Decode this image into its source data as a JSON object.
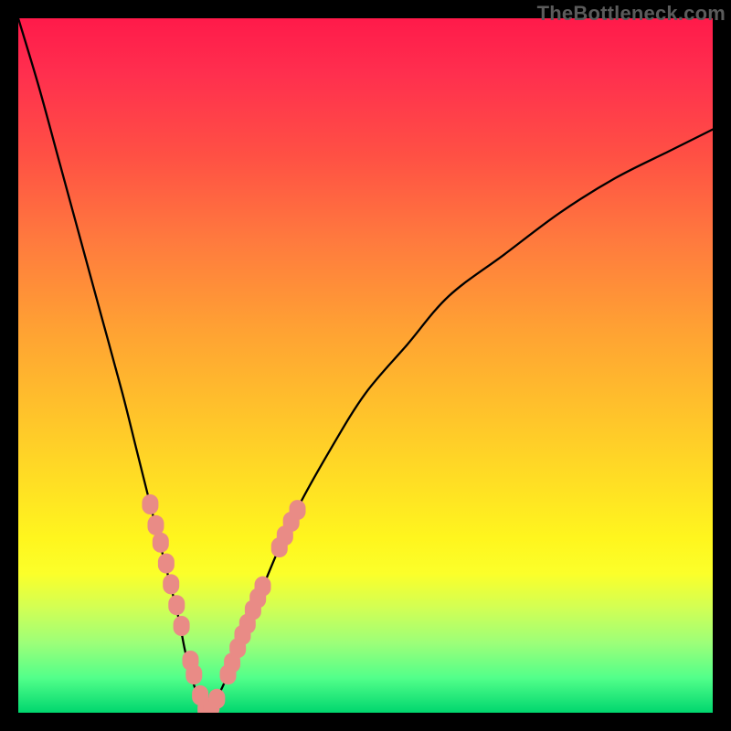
{
  "watermark": "TheBottleneck.com",
  "colors": {
    "background_black": "#000000",
    "gradient_top": "#ff1a4a",
    "gradient_bottom": "#00d66e",
    "curve": "#000000",
    "marker": "#e98b86"
  },
  "chart_data": {
    "type": "line",
    "title": "",
    "xlabel": "",
    "ylabel": "",
    "xlim": [
      0,
      100
    ],
    "ylim": [
      0,
      100
    ],
    "grid": false,
    "annotations": [
      "TheBottleneck.com"
    ],
    "series": [
      {
        "name": "bottleneck-curve",
        "x": [
          0,
          3,
          6,
          9,
          12,
          15,
          17,
          19,
          21,
          23,
          24,
          25,
          26,
          27,
          28,
          30,
          33,
          36,
          40,
          45,
          50,
          56,
          62,
          70,
          78,
          86,
          94,
          100
        ],
        "values": [
          100,
          90,
          79,
          68,
          57,
          46,
          38,
          30,
          22,
          14,
          9,
          5,
          2,
          0,
          1,
          5,
          12,
          20,
          29,
          38,
          46,
          53,
          60,
          66,
          72,
          77,
          81,
          84
        ]
      }
    ],
    "markers": [
      {
        "x": 19.0,
        "y": 30.0
      },
      {
        "x": 19.8,
        "y": 27.0
      },
      {
        "x": 20.5,
        "y": 24.5
      },
      {
        "x": 21.3,
        "y": 21.5
      },
      {
        "x": 22.0,
        "y": 18.5
      },
      {
        "x": 22.8,
        "y": 15.5
      },
      {
        "x": 23.5,
        "y": 12.5
      },
      {
        "x": 24.8,
        "y": 7.5
      },
      {
        "x": 25.3,
        "y": 5.5
      },
      {
        "x": 26.2,
        "y": 2.5
      },
      {
        "x": 27.0,
        "y": 0.5
      },
      {
        "x": 27.8,
        "y": 0.8
      },
      {
        "x": 28.6,
        "y": 2.0
      },
      {
        "x": 30.2,
        "y": 5.5
      },
      {
        "x": 30.8,
        "y": 7.2
      },
      {
        "x": 31.6,
        "y": 9.3
      },
      {
        "x": 32.3,
        "y": 11.2
      },
      {
        "x": 33.0,
        "y": 12.8
      },
      {
        "x": 33.8,
        "y": 14.8
      },
      {
        "x": 34.5,
        "y": 16.5
      },
      {
        "x": 35.2,
        "y": 18.2
      },
      {
        "x": 37.6,
        "y": 23.8
      },
      {
        "x": 38.4,
        "y": 25.5
      },
      {
        "x": 39.3,
        "y": 27.5
      },
      {
        "x": 40.2,
        "y": 29.2
      }
    ]
  }
}
